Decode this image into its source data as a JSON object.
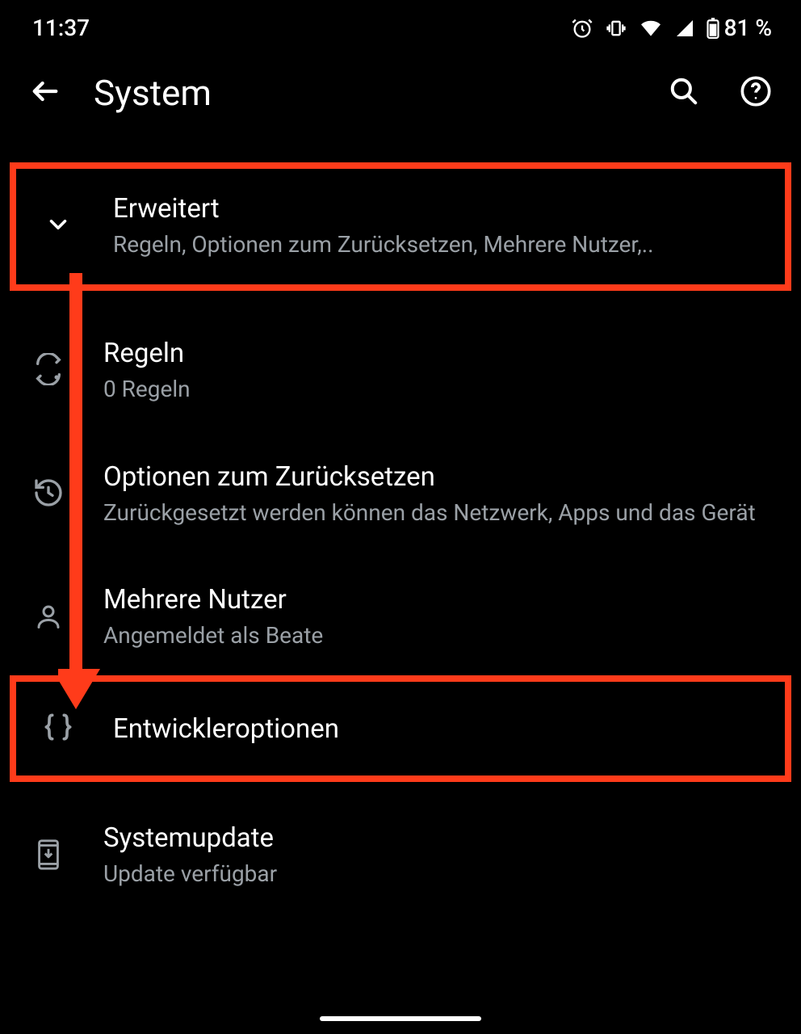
{
  "status": {
    "time": "11:37",
    "battery_text": "81 %"
  },
  "header": {
    "title": "System"
  },
  "items": {
    "advanced": {
      "title": "Erweitert",
      "subtitle": "Regeln, Optionen zum Zurücksetzen, Mehrere Nutzer,.."
    },
    "rules": {
      "title": "Regeln",
      "subtitle": "0 Regeln"
    },
    "reset": {
      "title": "Optionen zum Zurücksetzen",
      "subtitle": "Zurückgesetzt werden können das Netzwerk, Apps und das Gerät"
    },
    "users": {
      "title": "Mehrere Nutzer",
      "subtitle": "Angemeldet als Beate"
    },
    "devopts": {
      "title": "Entwickleroptionen"
    },
    "update": {
      "title": "Systemupdate",
      "subtitle": "Update verfügbar"
    }
  },
  "annotation": {
    "highlight_color": "#ff3b1a"
  }
}
